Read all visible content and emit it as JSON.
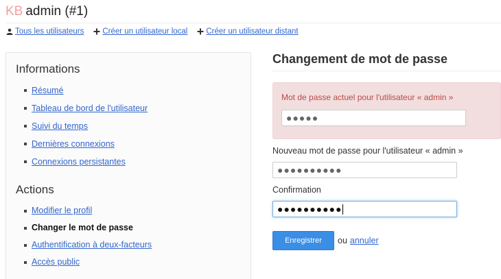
{
  "header": {
    "logo": "KB",
    "title": "admin (#1)"
  },
  "top_menu": {
    "all_users": "Tous les utilisateurs",
    "create_local": "Créer un utilisateur local",
    "create_remote": "Créer un utilisateur distant"
  },
  "sidebar": {
    "info_title": "Informations",
    "info_items": [
      "Résumé",
      "Tableau de bord de l'utilisateur",
      "Suivi du temps",
      "Dernières connexions",
      "Connexions persistantes"
    ],
    "actions_title": "Actions",
    "action_items": [
      "Modifier le profil",
      "Changer le mot de passe",
      "Authentification à deux-facteurs",
      "Accès public"
    ],
    "active_action": "Changer le mot de passe"
  },
  "form": {
    "title": "Changement de mot de passe",
    "current_label": "Mot de passe actuel pour l'utilisateur « admin »",
    "current_mask": "●●●●●",
    "new_label": "Nouveau mot de passe pour l'utilisateur « admin »",
    "new_mask": "●●●●●●●●●●",
    "confirm_label": "Confirmation",
    "confirm_mask": "●●●●●●●●●●",
    "save_label": "Enregistrer",
    "or_text": "ou",
    "cancel_label": "annuler"
  },
  "colors": {
    "link": "#3366cc",
    "alert_bg": "#f2dede",
    "alert_text": "#b94a48",
    "button": "#3a8ee6",
    "logo": "#f2a0a0"
  }
}
